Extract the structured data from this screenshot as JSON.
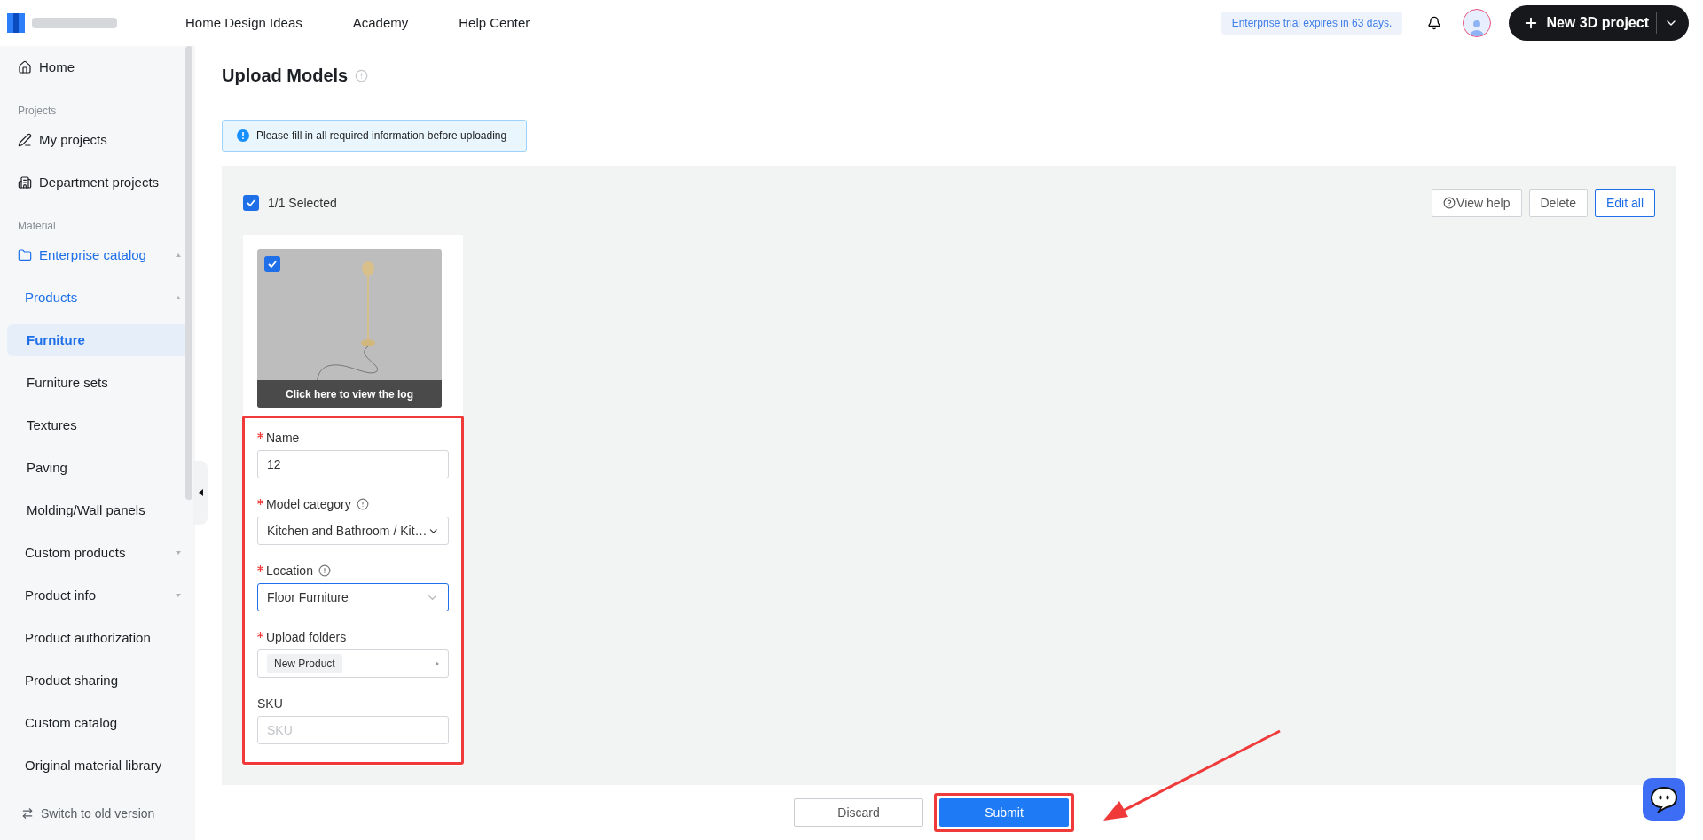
{
  "header": {
    "nav": [
      "Home Design Ideas",
      "Academy",
      "Help Center"
    ],
    "trial_notice": "Enterprise trial expires in 63 days.",
    "new_project_button": "New 3D project"
  },
  "sidebar": {
    "sections": [
      {
        "items": [
          {
            "label": "Home"
          }
        ]
      },
      {
        "label": "Projects",
        "items": [
          {
            "label": "My projects"
          },
          {
            "label": "Department projects"
          }
        ]
      },
      {
        "label": "Material",
        "items": [
          {
            "label": "Enterprise catalog",
            "expanded": true,
            "children": [
              {
                "label": "Products",
                "expanded": true,
                "children": [
                  {
                    "label": "Furniture",
                    "selected": true
                  },
                  {
                    "label": "Furniture sets",
                    "selected": false
                  },
                  {
                    "label": "Textures",
                    "selected": false
                  },
                  {
                    "label": "Paving",
                    "selected": false
                  },
                  {
                    "label": "Molding/Wall panels",
                    "selected": false
                  }
                ]
              },
              {
                "label": "Custom products",
                "expanded": false
              },
              {
                "label": "Product info",
                "expanded": false
              },
              {
                "label": "Product authorization"
              },
              {
                "label": "Product sharing"
              },
              {
                "label": "Custom catalog"
              },
              {
                "label": "Original material library"
              }
            ]
          }
        ]
      }
    ],
    "footer": "Switch to old version"
  },
  "page": {
    "title": "Upload Models",
    "alert": "Please fill in all required information before uploading",
    "toolbar": {
      "selection": "1/1 Selected",
      "checked": true,
      "buttons": [
        {
          "label": "View help",
          "kind": "help"
        },
        {
          "label": "Delete",
          "kind": "default"
        },
        {
          "label": "Edit all",
          "kind": "primary"
        }
      ]
    },
    "card": {
      "checked": true,
      "log_button": "Click here to view the log",
      "highlighted": true,
      "fields": [
        {
          "kind": "text",
          "label": "Name",
          "required": true,
          "value": "12"
        },
        {
          "kind": "select",
          "label": "Model category",
          "required": true,
          "info": true,
          "value": "Kitchen and Bathroom / Kit…",
          "focused": false
        },
        {
          "kind": "select",
          "label": "Location",
          "required": true,
          "info": true,
          "value": "Floor Furniture",
          "focused": true
        },
        {
          "kind": "tag",
          "label": "Upload folders",
          "required": true,
          "value": "New Product"
        },
        {
          "kind": "text",
          "label": "SKU",
          "required": false,
          "placeholder": "SKU"
        }
      ]
    }
  },
  "footer_buttons": [
    {
      "label": "Discard",
      "kind": "default",
      "highlighted": false
    },
    {
      "label": "Submit",
      "kind": "primary",
      "highlighted": true
    }
  ]
}
